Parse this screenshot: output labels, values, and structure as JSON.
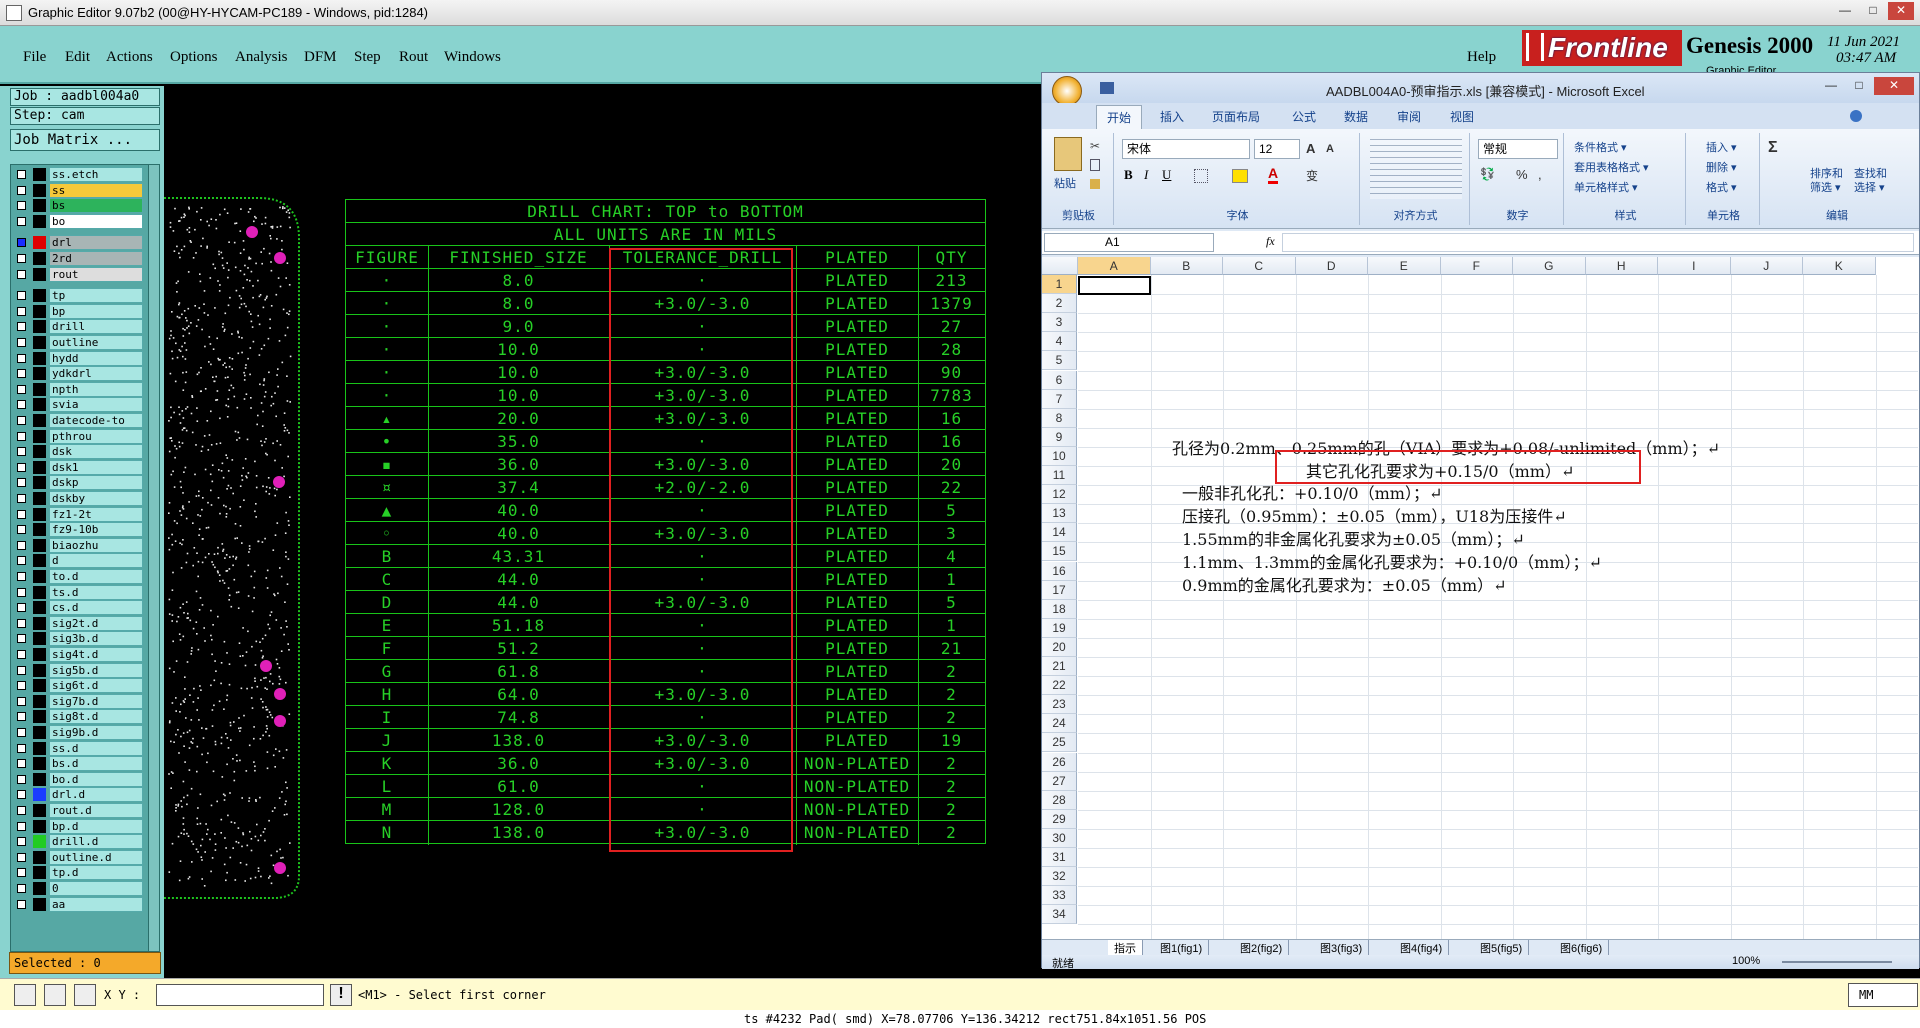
{
  "window": {
    "title": "Graphic Editor 9.07b2 (00@HY-HYCAM-PC189 - Windows, pid:1284)",
    "min": "—",
    "max": "□",
    "close": "✕"
  },
  "menu": {
    "items": [
      "File",
      "Edit",
      "Actions",
      "Options",
      "Analysis",
      "DFM",
      "Step",
      "Rout",
      "Windows"
    ],
    "help": "Help"
  },
  "brand": {
    "logo": "Frontline",
    "product": "Genesis 2000",
    "date": "11 Jun 2021",
    "time": "03:47 AM",
    "sub": "Graphic Editor"
  },
  "job": {
    "job": "Job : aadbl004a0",
    "step": "Step: cam",
    "matrix": "Job Matrix ...",
    "selected": "Selected : 0"
  },
  "layers": [
    {
      "name": "ss.etch",
      "color": "#000000"
    },
    {
      "name": "ss",
      "color": "#000000",
      "hl": "#f5c93a"
    },
    {
      "name": "bs",
      "color": "#000000",
      "hl": "#2db35c"
    },
    {
      "name": "bo",
      "color": "#000000",
      "hl": "#ffffff"
    },
    {
      "name": "drl",
      "color": "#e00000",
      "hl": "#a8b5b5",
      "sel": true
    },
    {
      "name": "2rd",
      "color": "#000000",
      "hl": "#a8b5b5"
    },
    {
      "name": "rout",
      "color": "#000000",
      "hl": "#dddddd"
    },
    {
      "name": "tp",
      "color": "#000000"
    },
    {
      "name": "bp",
      "color": "#000000"
    },
    {
      "name": "drill",
      "color": "#000000"
    },
    {
      "name": "outline",
      "color": "#000000"
    },
    {
      "name": "hydd",
      "color": "#000000"
    },
    {
      "name": "ydkdrl",
      "color": "#000000"
    },
    {
      "name": "npth",
      "color": "#000000"
    },
    {
      "name": "svia",
      "color": "#000000"
    },
    {
      "name": "datecode-to",
      "color": "#000000"
    },
    {
      "name": "pthrou",
      "color": "#000000"
    },
    {
      "name": "dsk",
      "color": "#000000"
    },
    {
      "name": "dsk1",
      "color": "#000000"
    },
    {
      "name": "dskp",
      "color": "#000000"
    },
    {
      "name": "dskby",
      "color": "#000000"
    },
    {
      "name": "fz1-2t",
      "color": "#000000"
    },
    {
      "name": "fz9-10b",
      "color": "#000000"
    },
    {
      "name": "biaozhu",
      "color": "#000000"
    },
    {
      "name": "d",
      "color": "#000000"
    },
    {
      "name": "to.d",
      "color": "#000000"
    },
    {
      "name": "ts.d",
      "color": "#000000"
    },
    {
      "name": "cs.d",
      "color": "#000000"
    },
    {
      "name": "sig2t.d",
      "color": "#000000"
    },
    {
      "name": "sig3b.d",
      "color": "#000000"
    },
    {
      "name": "sig4t.d",
      "color": "#000000"
    },
    {
      "name": "sig5b.d",
      "color": "#000000"
    },
    {
      "name": "sig6t.d",
      "color": "#000000"
    },
    {
      "name": "sig7b.d",
      "color": "#000000"
    },
    {
      "name": "sig8t.d",
      "color": "#000000"
    },
    {
      "name": "sig9b.d",
      "color": "#000000"
    },
    {
      "name": "ss.d",
      "color": "#000000"
    },
    {
      "name": "bs.d",
      "color": "#000000"
    },
    {
      "name": "bo.d",
      "color": "#000000"
    },
    {
      "name": "drl.d",
      "color": "#1a3cff"
    },
    {
      "name": "rout.d",
      "color": "#000000"
    },
    {
      "name": "bp.d",
      "color": "#000000"
    },
    {
      "name": "drill.d",
      "color": "#22cc22"
    },
    {
      "name": "outline.d",
      "color": "#000000"
    },
    {
      "name": "tp.d",
      "color": "#000000"
    },
    {
      "name": "0",
      "color": "#000000"
    },
    {
      "name": "aa",
      "color": "#000000"
    }
  ],
  "drill_chart": {
    "title": "DRILL CHART: TOP to BOTTOM",
    "subtitle": "ALL UNITS ARE IN MILS",
    "headers": [
      "FIGURE",
      "FINISHED_SIZE",
      "TOLERANCE_DRILL",
      "PLATED",
      "QTY"
    ],
    "rows": [
      [
        "·",
        "8.0",
        "·",
        "PLATED",
        "213"
      ],
      [
        "·",
        "8.0",
        "+3.0/-3.0",
        "PLATED",
        "1379"
      ],
      [
        "·",
        "9.0",
        "·",
        "PLATED",
        "27"
      ],
      [
        "·",
        "10.0",
        "·",
        "PLATED",
        "28"
      ],
      [
        "·",
        "10.0",
        "+3.0/-3.0",
        "PLATED",
        "90"
      ],
      [
        "·",
        "10.0",
        "+3.0/-3.0",
        "PLATED",
        "7783"
      ],
      [
        "▴",
        "20.0",
        "+3.0/-3.0",
        "PLATED",
        "16"
      ],
      [
        "•",
        "35.0",
        "·",
        "PLATED",
        "16"
      ],
      [
        "▪",
        "36.0",
        "+3.0/-3.0",
        "PLATED",
        "20"
      ],
      [
        "¤",
        "37.4",
        "+2.0/-2.0",
        "PLATED",
        "22"
      ],
      [
        "▲",
        "40.0",
        "·",
        "PLATED",
        "5"
      ],
      [
        "◦",
        "40.0",
        "+3.0/-3.0",
        "PLATED",
        "3"
      ],
      [
        "B",
        "43.31",
        "·",
        "PLATED",
        "4"
      ],
      [
        "C",
        "44.0",
        "·",
        "PLATED",
        "1"
      ],
      [
        "D",
        "44.0",
        "+3.0/-3.0",
        "PLATED",
        "5"
      ],
      [
        "E",
        "51.18",
        "·",
        "PLATED",
        "1"
      ],
      [
        "F",
        "51.2",
        "·",
        "PLATED",
        "21"
      ],
      [
        "G",
        "61.8",
        "·",
        "PLATED",
        "2"
      ],
      [
        "H",
        "64.0",
        "+3.0/-3.0",
        "PLATED",
        "2"
      ],
      [
        "I",
        "74.8",
        "·",
        "PLATED",
        "2"
      ],
      [
        "J",
        "138.0",
        "+3.0/-3.0",
        "PLATED",
        "19"
      ],
      [
        "K",
        "36.0",
        "+3.0/-3.0",
        "NON-PLATED",
        "2"
      ],
      [
        "L",
        "61.0",
        "·",
        "NON-PLATED",
        "2"
      ],
      [
        "M",
        "128.0",
        "·",
        "NON-PLATED",
        "2"
      ],
      [
        "N",
        "138.0",
        "+3.0/-3.0",
        "NON-PLATED",
        "2"
      ]
    ]
  },
  "excel": {
    "title": "AADBL004A0-预审指示.xls [兼容模式] - Microsoft Excel",
    "tabs": [
      "开始",
      "插入",
      "页面布局",
      "公式",
      "数据",
      "审阅",
      "视图"
    ],
    "groups": [
      "剪贴板",
      "字体",
      "对齐方式",
      "数字",
      "样式",
      "单元格",
      "编辑"
    ],
    "paste": "粘贴",
    "font": "宋体",
    "size": "12",
    "number_format": "常规",
    "style_items": [
      "条件格式 ▾",
      "套用表格格式 ▾",
      "单元格样式 ▾"
    ],
    "cell_items": [
      "插入 ▾",
      "删除 ▾",
      "格式 ▾"
    ],
    "edit_items": [
      "排序和\n筛选 ▾",
      "查找和\n选择 ▾"
    ],
    "name_box": "A1",
    "fx": "fx",
    "columns": [
      "A",
      "B",
      "C",
      "D",
      "E",
      "F",
      "G",
      "H",
      "I",
      "J",
      "K"
    ],
    "notes": [
      "孔径为0.2mm、0.25mm的孔（VIA）要求为+0.08/-unlimited（mm）；↵",
      "其它孔化孔要求为+0.15/0（mm）↵",
      "一般非孔化孔：+0.10/0（mm）；↵",
      "压接孔（0.95mm）：±0.05（mm），U18为压接件↵",
      "1.55mm的非金属化孔要求为±0.05（mm）；↵",
      "1.1mm、1.3mm的金属化孔要求为：+0.10/0（mm）；↵",
      "0.9mm的金属化孔要求为：±0.05（mm）↵"
    ],
    "sheets": [
      "指示",
      "图1(fig1)",
      "图2(fig2)",
      "图3(fig3)",
      "图4(fig4)",
      "图5(fig5)",
      "图6(fig6)"
    ],
    "status": "就绪",
    "zoom": "100%"
  },
  "bottom": {
    "xy_label": "X Y :",
    "prompt": "<M1> - Select first corner",
    "units": "MM",
    "info": "ts #4232 Pad( smd) X=78.07706 Y=136.34212 rect751.84x1051.56 POS"
  },
  "colors": {
    "accent_red": "#e02020",
    "chart_green": "#27d027",
    "panel_teal": "#89d3cf"
  }
}
